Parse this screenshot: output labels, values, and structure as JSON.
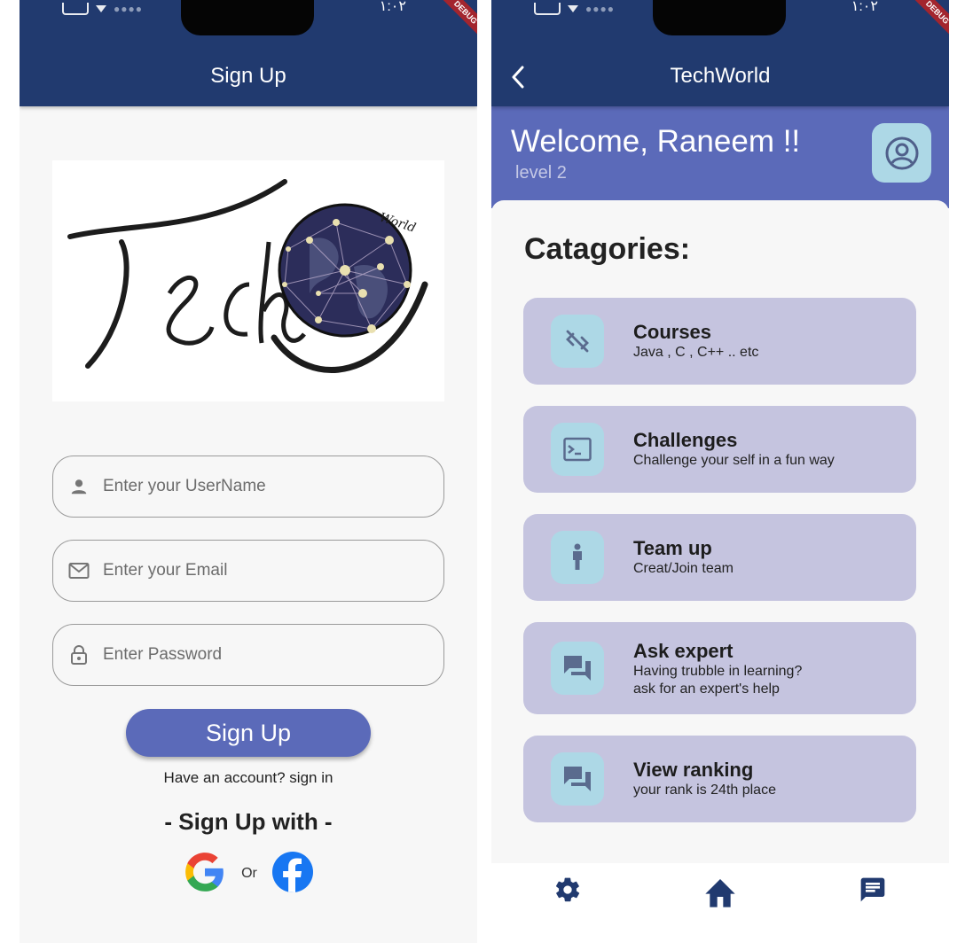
{
  "colors": {
    "app_bar": "#213a6f",
    "primary": "#5b6ab9",
    "card": "#c5c4df",
    "icon_box": "#add8e6",
    "background": "#f7f7f7"
  },
  "status_bar": {
    "time": "١:٠٢",
    "debug_banner": "DEBUG"
  },
  "signup_screen": {
    "app_bar_title": "Sign Up",
    "logo": {
      "wordmark": "Tech",
      "sub_wordmark": "World",
      "icon": "globe-network-logo"
    },
    "fields": [
      {
        "icon": "person-icon",
        "placeholder": "Enter your UserName",
        "value": ""
      },
      {
        "icon": "mail-icon",
        "placeholder": "Enter your Email",
        "value": ""
      },
      {
        "icon": "lock-icon",
        "placeholder": "Enter Password",
        "value": ""
      }
    ],
    "signup_button": "Sign Up",
    "have_account_link": "Have an account? sign in",
    "signup_with_heading": "- Sign Up with -",
    "social": {
      "google_icon": "google-icon",
      "or_text": "Or",
      "facebook_icon": "facebook-icon"
    }
  },
  "home_screen": {
    "app_bar_title": "TechWorld",
    "back_icon": "chevron-left-icon",
    "welcome_text": "Welcome, Raneem !!",
    "level_text": "level 2",
    "profile_icon": "account-circle-icon",
    "categories_heading": "Catagories:",
    "categories": [
      {
        "icon": "code-off-icon",
        "title": "Courses",
        "subtitle": "Java , C , C++ .. etc"
      },
      {
        "icon": "terminal-icon",
        "title": "Challenges",
        "subtitle": "Challenge your self in a fun way"
      },
      {
        "icon": "person-standing-icon",
        "title": "Team up",
        "subtitle": "Creat/Join team"
      },
      {
        "icon": "forum-icon",
        "title": "Ask expert",
        "subtitle": "Having trubble in learning?",
        "subtitle2": "ask for an expert's help"
      },
      {
        "icon": "forum-icon",
        "title": "View ranking",
        "subtitle": "your rank is 24th place"
      }
    ],
    "bottom_nav": [
      {
        "icon": "gear-icon",
        "label": "Settings"
      },
      {
        "icon": "home-icon",
        "label": "Home"
      },
      {
        "icon": "chat-icon",
        "label": "Chat"
      }
    ]
  }
}
